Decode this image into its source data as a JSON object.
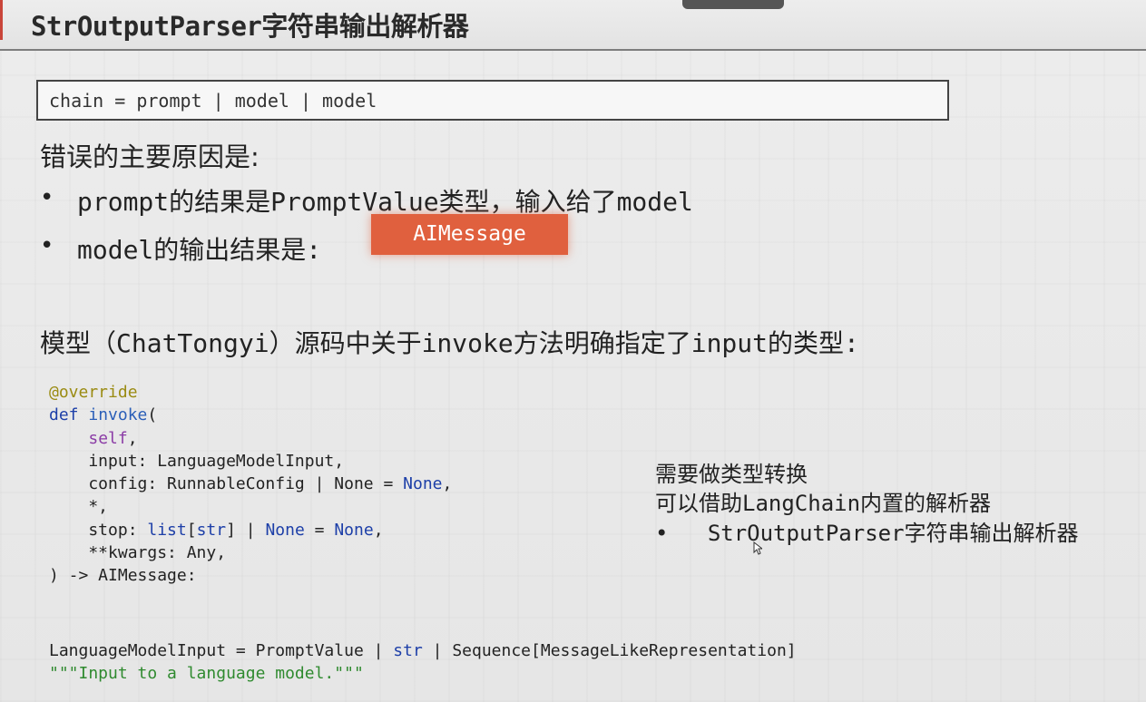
{
  "header": {
    "title": "StrOutputParser字符串输出解析器"
  },
  "code_box": {
    "text": "chain = prompt | model | model"
  },
  "reasons": {
    "title": "错误的主要原因是:",
    "bullet_symbol": "•",
    "items": [
      "prompt的结果是PromptValue类型，输入给了model",
      "model的输出结果是:"
    ],
    "badge": "AIMessage"
  },
  "model_note": "模型（ChatTongyi）源码中关于invoke方法明确指定了input的类型:",
  "code_lines": [
    {
      "t": [
        [
          "kw-dec",
          "@override"
        ]
      ]
    },
    {
      "t": [
        [
          "kw-def",
          "def "
        ],
        [
          "kw-fn",
          "invoke"
        ],
        [
          "",
          "("
        ]
      ]
    },
    {
      "t": [
        [
          "",
          "    "
        ],
        [
          "kw-self",
          "self"
        ],
        [
          "",
          ","
        ]
      ]
    },
    {
      "t": [
        [
          "",
          "    input: LanguageModelInput,"
        ]
      ]
    },
    {
      "t": [
        [
          "",
          "    config: RunnableConfig | None = "
        ],
        [
          "kw-none",
          "None"
        ],
        [
          "",
          ","
        ]
      ]
    },
    {
      "t": [
        [
          "",
          "    *,"
        ]
      ]
    },
    {
      "t": [
        [
          "",
          "    stop: "
        ],
        [
          "kw-none",
          "list"
        ],
        [
          "",
          "["
        ],
        [
          "kw-none",
          "str"
        ],
        [
          "",
          "] | "
        ],
        [
          "kw-none",
          "None"
        ],
        [
          "",
          " = "
        ],
        [
          "kw-none",
          "None"
        ],
        [
          "",
          ","
        ]
      ]
    },
    {
      "t": [
        [
          "",
          "    **kwargs: Any,"
        ]
      ]
    },
    {
      "t": [
        [
          "",
          ") -> AIMessage:"
        ]
      ]
    }
  ],
  "code_lines2": [
    {
      "t": [
        [
          "",
          "LanguageModelInput = PromptValue | "
        ],
        [
          "kw-none",
          "str"
        ],
        [
          "",
          " | Sequence[MessageLikeRepresentation]"
        ]
      ]
    },
    {
      "t": [
        [
          "kw-str",
          "\"\"\"Input to a language model.\"\"\""
        ]
      ]
    }
  ],
  "side_note": {
    "line1": "需要做类型转换",
    "line2": "可以借助LangChain内置的解析器",
    "bullet_symbol": "•",
    "bullet": "StrOutputParser字符串输出解析器"
  }
}
